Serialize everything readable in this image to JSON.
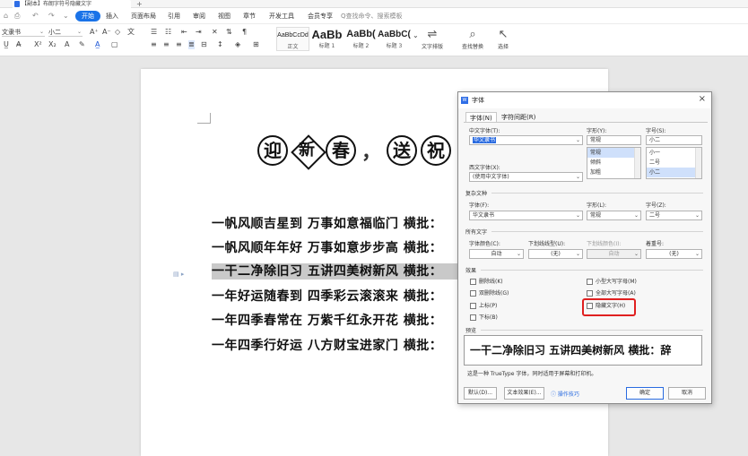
{
  "window": {
    "tab_title": "【副本】布朗字符号隐藏文字",
    "new_tab": "+"
  },
  "menubar": {
    "quick_icons": [
      "⌂",
      "⎙",
      "↶",
      "↷",
      "⌄"
    ],
    "items": [
      "开始",
      "插入",
      "页面布局",
      "引用",
      "审阅",
      "视图",
      "章节",
      "开发工具",
      "会员专享"
    ],
    "search_placeholder": "Q查找命令、搜索模板"
  },
  "ribbon": {
    "font_name": "文隶书",
    "font_size": "小二",
    "styles": [
      {
        "sample": "AaBbCcDd",
        "name": "正文"
      },
      {
        "sample": "AaBb",
        "name": "标题 1"
      },
      {
        "sample": "AaBb(",
        "name": "标题 2"
      },
      {
        "sample": "AaBbC(",
        "name": "标题 3"
      }
    ],
    "text_layout_label": "文字排版",
    "find_replace_label": "查找替换",
    "select_label": "选择"
  },
  "document": {
    "heading_chars": [
      "迎",
      "新",
      "春",
      "，",
      "送",
      "祝"
    ],
    "lines": [
      "一帆风顺吉星到 万事如意福临门 横批：",
      "一帆风顺年年好 万事如意步步高 横批：",
      "一干二净除旧习 五讲四美树新风 横批：",
      "一年好运随春到 四季彩云滚滚来 横批：",
      "一年四季春常在 万紫千红永开花 横批：",
      "一年四季行好运 八方财宝进家门 横批："
    ],
    "highlighted_line_index": 2
  },
  "font_dialog": {
    "title": "字体",
    "close": "×",
    "tabs": [
      "字体(N)",
      "字符间距(R)"
    ],
    "chinese_font_label": "中文字体(T):",
    "chinese_font_value": "华文隶书",
    "style_label": "字形(Y):",
    "style_value": "常规",
    "style_options": [
      "常规",
      "倾斜",
      "加粗"
    ],
    "size_label": "字号(S):",
    "size_value": "小二",
    "size_options": [
      "小一",
      "二号",
      "小二"
    ],
    "western_font_label": "西文字体(X):",
    "western_font_value": "(使用中文字体)",
    "complex_section": "复杂文种",
    "complex_font_label": "字体(F):",
    "complex_font_value": "华文隶书",
    "complex_style_label": "字形(L):",
    "complex_style_value": "常规",
    "complex_size_label": "字号(Z):",
    "complex_size_value": "二号",
    "all_text_section": "所有文字",
    "font_color_label": "字体颜色(C):",
    "font_color_value": "自动",
    "underline_type_label": "下划线线型(U):",
    "underline_type_value": "(无)",
    "underline_color_label": "下划线颜色(I):",
    "underline_color_value": "自动",
    "emphasis_label": "着重号:",
    "emphasis_value": "(无)",
    "effects_section": "效果",
    "effects": {
      "strikethrough": "删除线(K)",
      "double_strikethrough": "双删除线(G)",
      "superscript": "上标(P)",
      "subscript": "下标(B)",
      "small_caps": "小型大写字母(M)",
      "all_caps": "全部大写字母(A)",
      "hidden": "隐藏文字(H)"
    },
    "preview_section": "预览",
    "preview_text": "一干二净除旧习 五讲四美树新风 横批：辞",
    "note": "这是一种 TrueType 字体，同时适用于屏幕和打印机。",
    "buttons": {
      "default": "默认(D)...",
      "text_effect": "文本效果(E)...",
      "tips": "操作技巧",
      "ok": "确定",
      "cancel": "取消"
    }
  }
}
